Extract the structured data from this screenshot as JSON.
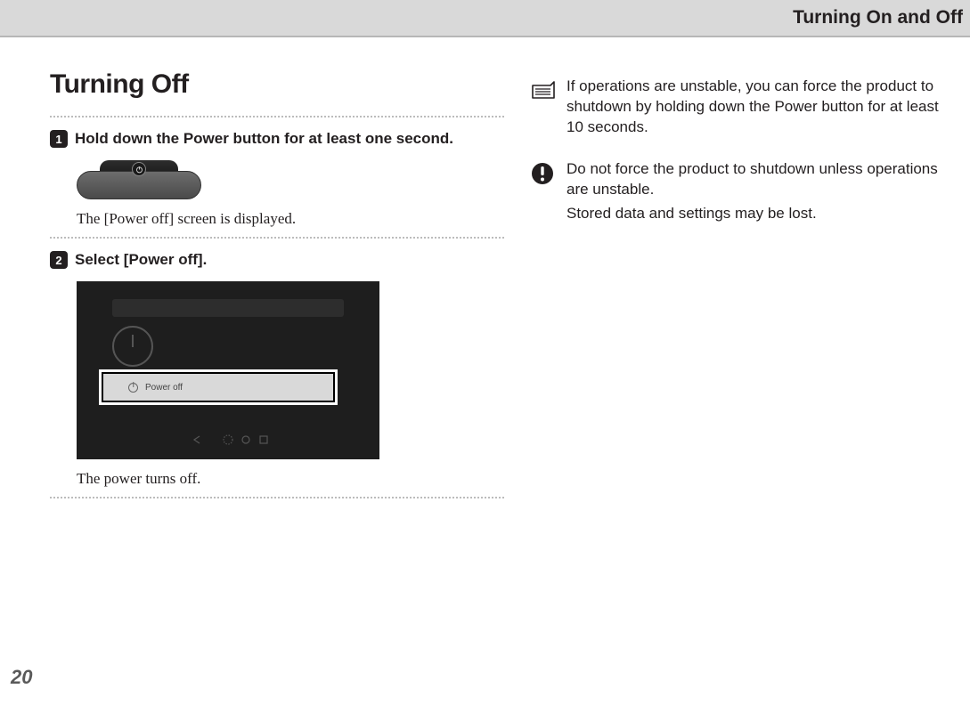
{
  "header": {
    "title": "Turning On and Off"
  },
  "left": {
    "heading": "Turning Off",
    "step1": {
      "num": "1",
      "label": "Hold down the Power button for at least one second.",
      "result": "The [Power off] screen is displayed."
    },
    "step2": {
      "num": "2",
      "label": "Select [Power off].",
      "dialog_label": "Power off",
      "result": "The power turns off."
    }
  },
  "right": {
    "note1": "If operations are unstable, you can force the product to shutdown by holding down the Power button for at least 10 seconds.",
    "caution1": "Do not force the product to shutdown unless operations are unstable.",
    "caution2": "Stored data and settings may be lost."
  },
  "page_number": "20"
}
